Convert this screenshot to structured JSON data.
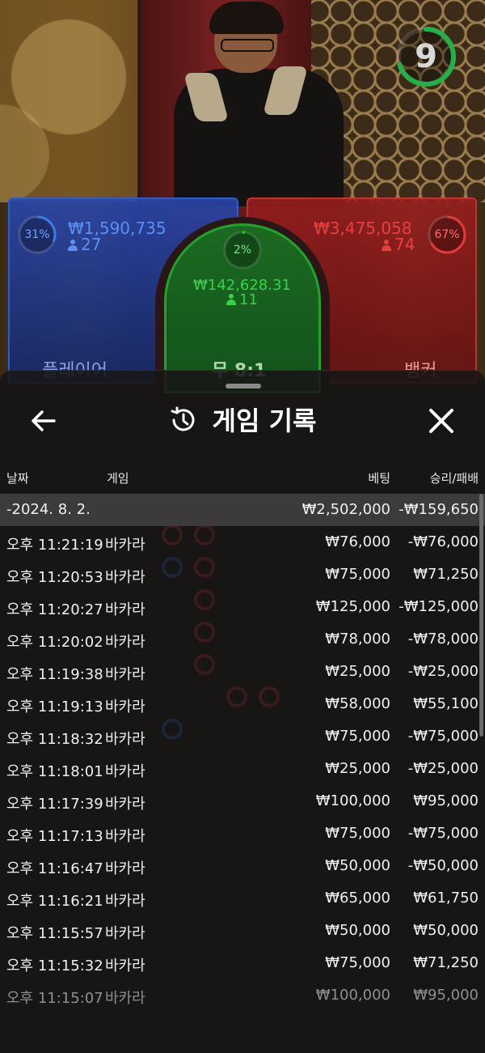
{
  "game": {
    "timer": "9",
    "player": {
      "pct": "31%",
      "amount": "₩1,590,735",
      "count": "27",
      "label": "플레이어"
    },
    "tie": {
      "pct": "2%",
      "amount": "₩142,628.31",
      "count": "11",
      "label": "무 8:1"
    },
    "banker": {
      "pct": "67%",
      "amount": "₩3,475,058",
      "count": "74",
      "label": "뱅커"
    },
    "colors": {
      "player": "#2c5cd0",
      "tie": "#1fa32a",
      "banker": "#c83030",
      "timer": "#22b04a"
    }
  },
  "panel": {
    "title": "게임 기록",
    "back_icon": "arrow-left-icon",
    "history_icon": "history-icon",
    "close_icon": "close-icon",
    "columns": {
      "date": "날짜",
      "game": "게임",
      "bet": "베팅",
      "result": "승리/패배"
    },
    "total": {
      "date": "-2024. 8. 2.",
      "bet": "₩2,502,000",
      "result": "-₩159,650"
    },
    "rows": [
      {
        "time": "오후 11:21:19",
        "game": "바카라",
        "bet": "₩76,000",
        "result": "-₩76,000"
      },
      {
        "time": "오후 11:20:53",
        "game": "바카라",
        "bet": "₩75,000",
        "result": "₩71,250"
      },
      {
        "time": "오후 11:20:27",
        "game": "바카라",
        "bet": "₩125,000",
        "result": "-₩125,000"
      },
      {
        "time": "오후 11:20:02",
        "game": "바카라",
        "bet": "₩78,000",
        "result": "-₩78,000"
      },
      {
        "time": "오후 11:19:38",
        "game": "바카라",
        "bet": "₩25,000",
        "result": "-₩25,000"
      },
      {
        "time": "오후 11:19:13",
        "game": "바카라",
        "bet": "₩58,000",
        "result": "₩55,100"
      },
      {
        "time": "오후 11:18:32",
        "game": "바카라",
        "bet": "₩75,000",
        "result": "-₩75,000"
      },
      {
        "time": "오후 11:18:01",
        "game": "바카라",
        "bet": "₩25,000",
        "result": "-₩25,000"
      },
      {
        "time": "오후 11:17:39",
        "game": "바카라",
        "bet": "₩100,000",
        "result": "₩95,000"
      },
      {
        "time": "오후 11:17:13",
        "game": "바카라",
        "bet": "₩75,000",
        "result": "-₩75,000"
      },
      {
        "time": "오후 11:16:47",
        "game": "바카라",
        "bet": "₩50,000",
        "result": "-₩50,000"
      },
      {
        "time": "오후 11:16:21",
        "game": "바카라",
        "bet": "₩65,000",
        "result": "₩61,750"
      },
      {
        "time": "오후 11:15:57",
        "game": "바카라",
        "bet": "₩50,000",
        "result": "₩50,000"
      },
      {
        "time": "오후 11:15:32",
        "game": "바카라",
        "bet": "₩75,000",
        "result": "₩71,250"
      },
      {
        "time": "오후 11:15:07",
        "game": "바카라",
        "bet": "₩100,000",
        "result": "₩95,000"
      }
    ]
  }
}
